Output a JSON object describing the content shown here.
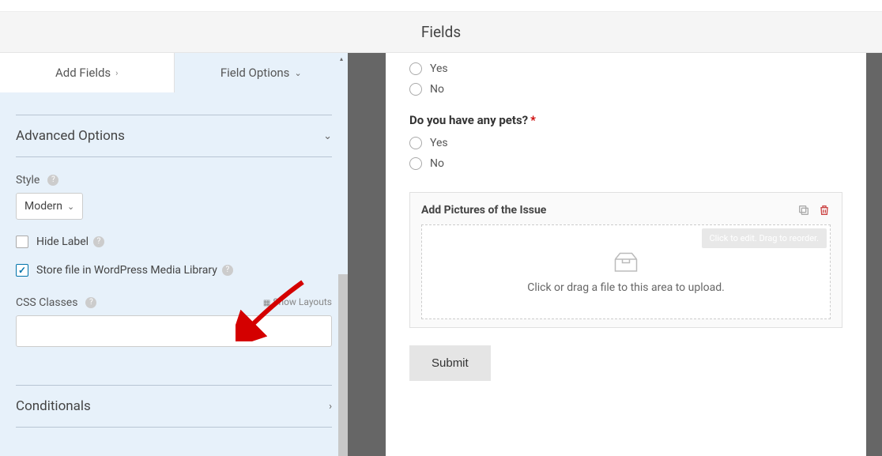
{
  "header": {
    "title": "Fields"
  },
  "tabs": {
    "add_fields": "Add Fields",
    "field_options": "Field Options"
  },
  "sidebar": {
    "advanced_options": "Advanced Options",
    "style": {
      "label": "Style",
      "value": "Modern"
    },
    "hide_label": "Hide Label",
    "store_file": "Store file in WordPress Media Library",
    "css_classes": "CSS Classes",
    "show_layouts": "Show Layouts",
    "conditionals": "Conditionals"
  },
  "form": {
    "radio_yes": "Yes",
    "radio_no": "No",
    "pets_question": "Do you have any pets?",
    "pets_yes": "Yes",
    "pets_no": "No",
    "upload_title": "Add Pictures of the Issue",
    "upload_hint": "Click to edit. Drag to reorder.",
    "upload_text": "Click or drag a file to this area to upload.",
    "submit": "Submit"
  }
}
